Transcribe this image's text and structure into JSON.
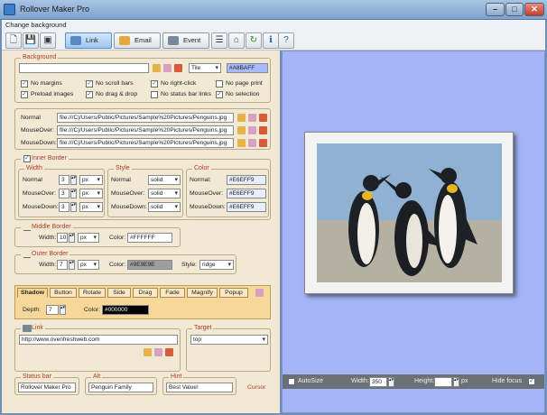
{
  "app": {
    "title": "Rollover Maker Pro"
  },
  "menu": {
    "items": [
      "Change background"
    ]
  },
  "toolbar": {
    "link_label": "Link",
    "email_label": "Email",
    "event_label": "Event"
  },
  "background": {
    "label": "Background",
    "path": "",
    "mode": "Tile",
    "color": "#A8BAFF",
    "options": {
      "no_margins": "No margins",
      "no_scroll_bars": "No scroll bars",
      "no_right_click": "No right-click",
      "no_page_print": "No page print",
      "preload_images": "Preload images",
      "no_drag_drop": "No drag & drop",
      "no_status_bar_links": "No status bar links",
      "no_selection": "No selection"
    }
  },
  "images": {
    "normal_label": "Normal",
    "mouseover_label": "MouseOver:",
    "mousedown_label": "MouseDown:",
    "normal": "file:///C|/Users/Public/Pictures/Sample%20Pictures/Penguins.jpg",
    "mouseover": "file:///C|/Users/Public/Pictures/Sample%20Pictures/Penguins.jpg",
    "mousedown": "file:///C|/Users/Public/Pictures/Sample%20Pictures/Penguins.jpg"
  },
  "inner_border": {
    "label": "Inner Border",
    "width_label": "Width",
    "style_label": "Style",
    "color_label": "Color",
    "normal_label": "Normal",
    "mouseover_label": "MouseOver:",
    "mousedown_label": "MouseDown:",
    "normal_color_label": "Normal:",
    "width": {
      "normal": "3",
      "mouseover": "3",
      "mousedown": "3",
      "unit": "px"
    },
    "style": {
      "normal": "solid",
      "mouseover": "solid",
      "mousedown": "solid"
    },
    "color": {
      "normal": "#E6EFF9",
      "mouseover": "#E6EFF9",
      "mousedown": "#E6EFF9"
    }
  },
  "middle_border": {
    "label": "Middle Border",
    "width_label": "Width:",
    "width": "10",
    "unit": "px",
    "color_label": "Color:",
    "color": "#FFFFFF"
  },
  "outer_border": {
    "label": "Outer Border",
    "width_label": "Width:",
    "width": "7",
    "unit": "px",
    "color_label": "Color:",
    "color": "#9E9E9E",
    "style_label": "Style:",
    "style": "ridge"
  },
  "effects": {
    "tabs": [
      "Shadow",
      "Button",
      "Rotate",
      "Side",
      "Drag",
      "Fade",
      "Magnify",
      "Popup"
    ],
    "depth_label": "Depth:",
    "depth": "7",
    "color_label": "Color:",
    "color": "#000000"
  },
  "link": {
    "label": "Link",
    "url": "http://www.ovenfreshweb.com"
  },
  "target": {
    "label": "Target",
    "value": "top"
  },
  "bottom": {
    "status_label": "Status bar",
    "status_value": "Rollover Maker Pro",
    "alt_label": "Alt",
    "alt_value": "Penguin Family",
    "hint_label": "Hint",
    "hint_value": "Best Value!",
    "cursor_label": "Cursor"
  },
  "preview": {
    "autosize_label": "AutoSize",
    "width_label": "Width:",
    "width": "350",
    "height_label": "Height:",
    "height": "",
    "unit": "px",
    "hide_focus_label": "Hide focus"
  },
  "colors": {
    "preview_bg": "#A4B4F4",
    "panel_bg": "#F2E9D4",
    "accent_label": "#B23B22",
    "shadow_tab_bg": "#F7D79A"
  }
}
